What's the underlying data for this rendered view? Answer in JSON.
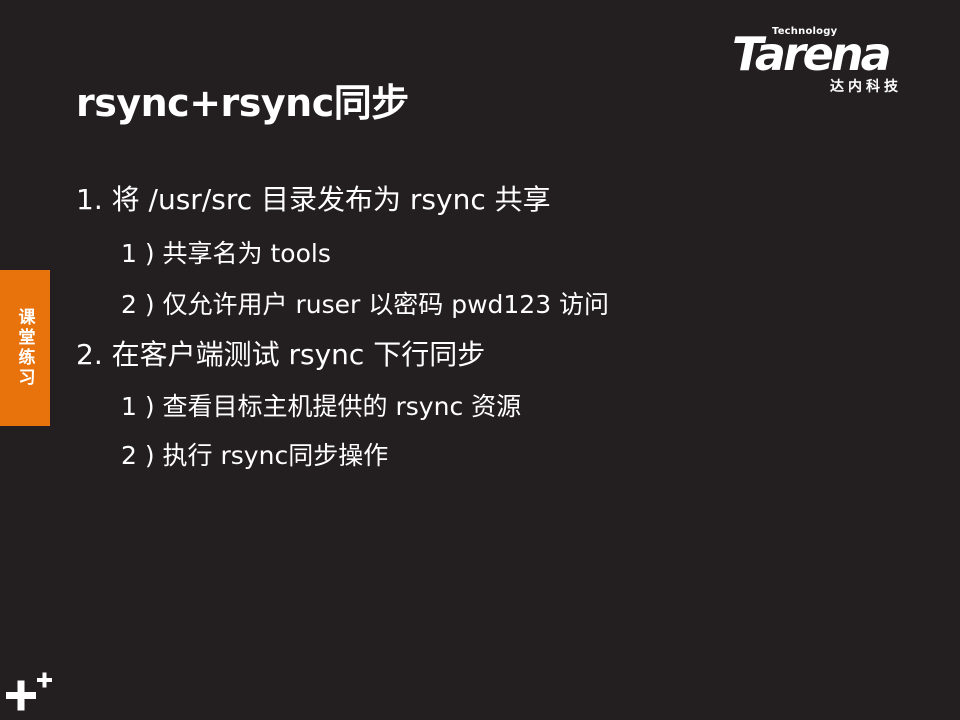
{
  "logo": {
    "tagline": "Technology",
    "name": "Tarena",
    "cn_name": "达内科技"
  },
  "title": "rsync+rsync同步",
  "side_tab": {
    "label": "课堂练习",
    "color": "#e8720c"
  },
  "content": {
    "items": [
      {
        "text": "1. 将 /usr/src 目录发布为 rsync 共享",
        "subitems": [
          "1 ) 共享名为 tools",
          "2 ) 仅允许用户 ruser 以密码 pwd123 访问"
        ]
      },
      {
        "text": "2. 在客户端测试 rsync 下行同步",
        "subitems": [
          "1 ) 查看目标主机提供的 rsync 资源",
          "2 ) 执行 rsync同步操作"
        ]
      }
    ]
  },
  "icons": {
    "corner": "plus-icon"
  },
  "colors": {
    "background": "#231f20",
    "text": "#ffffff",
    "accent": "#e8720c"
  }
}
